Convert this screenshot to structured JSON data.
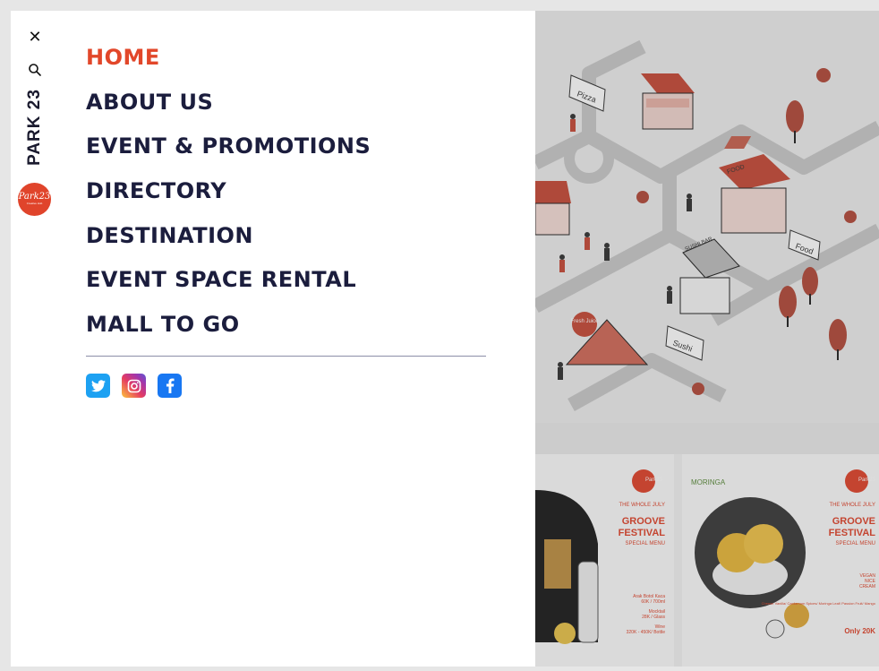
{
  "rail": {
    "close_glyph": "✕",
    "brand_text": "PARK 23",
    "logo_text": "Park23",
    "logo_subtext": "Creative Hub"
  },
  "menu": {
    "items": [
      {
        "label": "HOME",
        "active": true
      },
      {
        "label": "ABOUT US"
      },
      {
        "label": "EVENT & PROMOTIONS"
      },
      {
        "label": "DIRECTORY"
      },
      {
        "label": "DESTINATION"
      },
      {
        "label": "EVENT SPACE RENTAL"
      },
      {
        "label": "MALL TO GO"
      }
    ]
  },
  "social": [
    {
      "name": "twitter"
    },
    {
      "name": "instagram"
    },
    {
      "name": "facebook"
    }
  ],
  "map_signs": {
    "pizza": "Pizza",
    "food1": "FOOD",
    "food2": "Food",
    "sushi": "Sushi",
    "sushi_bar": "SUSHI BAR",
    "fresh_juice": "Fresh Juice"
  },
  "poster_left": {
    "logo": "Park23",
    "kicker": "THE WHOLE JULY",
    "title1": "GROOVE",
    "title2": "FESTIVAL",
    "subtitle": "SPECIAL MENU",
    "item1": "Arak Botol Kaca",
    "item1_price": "60K / 700ml",
    "item2": "Mocktail",
    "item2_price": "28K / Glass",
    "item3": "Wine",
    "item3_price": "320K - 450K/ Bottle"
  },
  "poster_right": {
    "brand": "MORINGA",
    "logo": "Park23",
    "kicker": "THE WHOLE JULY",
    "title1": "GROOVE",
    "title2": "FESTIVAL",
    "subtitle": "SPECIAL MENU",
    "item1": "VEGAN",
    "item2": "NICE",
    "item3": "CREAM",
    "flavors": "Cheese Vanilla/ Cardamom Spices/ Moringa Leaf/ Passion Fruit/ Mango",
    "price": "Only 20K"
  },
  "colors": {
    "accent": "#e2472a",
    "menu_text": "#1b1d3d"
  }
}
